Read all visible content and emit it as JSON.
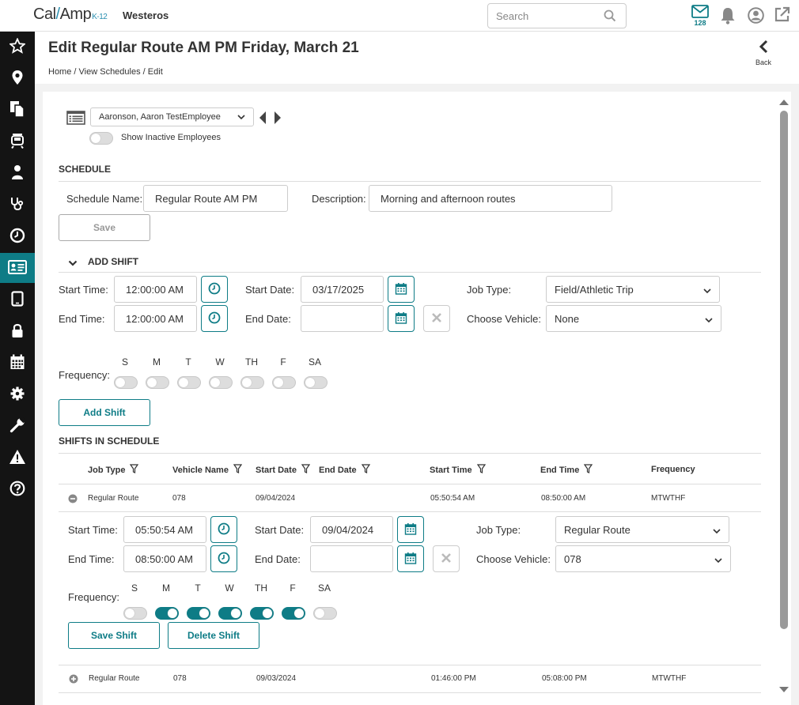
{
  "topbar": {
    "logo_main": "Cal",
    "logo_rest": "Amp",
    "logo_k12": "K-12",
    "org_name": "Westeros",
    "search_placeholder": "Search",
    "mail_count": "128"
  },
  "sidebar": {
    "items": [
      {
        "icon": "star-icon"
      },
      {
        "icon": "map-pin-icon"
      },
      {
        "icon": "documents-icon"
      },
      {
        "icon": "bus-icon"
      },
      {
        "icon": "driver-icon"
      },
      {
        "icon": "stethoscope-icon"
      },
      {
        "icon": "clock-icon"
      },
      {
        "icon": "id-card-icon",
        "active": true
      },
      {
        "icon": "tablet-icon"
      },
      {
        "icon": "lock-icon"
      },
      {
        "icon": "calendar-icon"
      },
      {
        "icon": "gear-icon"
      },
      {
        "icon": "wrench-icon"
      },
      {
        "icon": "warning-icon"
      },
      {
        "icon": "help-icon"
      }
    ],
    "active_color": "#0e7c86"
  },
  "header": {
    "title": "Edit Regular Route AM PM Friday, March 21",
    "breadcrumb": [
      "Home",
      "View Schedules",
      "Edit"
    ],
    "back_label": "Back"
  },
  "employee": {
    "selected": "Aaronson, Aaron TestEmployee",
    "show_inactive_label": "Show Inactive Employees"
  },
  "schedule": {
    "section_title": "SCHEDULE",
    "name_label": "Schedule Name:",
    "name_value": "Regular Route AM PM",
    "description_label": "Description:",
    "description_value": "Morning and afternoon routes",
    "save_label": "Save"
  },
  "add_shift": {
    "section_title": "ADD SHIFT",
    "start_time_label": "Start Time:",
    "start_time_value": "12:00:00 AM",
    "end_time_label": "End Time:",
    "end_time_value": "12:00:00 AM",
    "start_date_label": "Start Date:",
    "start_date_value": "03/17/2025",
    "end_date_label": "End Date:",
    "end_date_value": "",
    "job_type_label": "Job Type:",
    "job_type_value": "Field/Athletic Trip",
    "vehicle_label": "Choose Vehicle:",
    "vehicle_value": "None",
    "frequency_label": "Frequency:",
    "days": [
      "S",
      "M",
      "T",
      "W",
      "TH",
      "F",
      "SA"
    ],
    "days_on": [
      false,
      false,
      false,
      false,
      false,
      false,
      false
    ],
    "add_label": "Add Shift"
  },
  "shifts": {
    "section_title": "SHIFTS IN SCHEDULE",
    "columns": [
      "Job Type",
      "Vehicle Name",
      "Start Date",
      "End Date",
      "Start Time",
      "End Time",
      "Frequency"
    ],
    "rows": [
      {
        "job_type": "Regular Route",
        "vehicle": "078",
        "start_date": "09/04/2024",
        "end_date": "",
        "start_time": "05:50:54 AM",
        "end_time": "08:50:00 AM",
        "frequency": "MTWTHF",
        "expanded": true
      },
      {
        "job_type": "Regular Route",
        "vehicle": "078",
        "start_date": "09/03/2024",
        "end_date": "",
        "start_time": "01:46:00 PM",
        "end_time": "05:08:00 PM",
        "frequency": "MTWTHF",
        "expanded": false
      }
    ],
    "editor": {
      "start_time_label": "Start Time:",
      "start_time_value": "05:50:54 AM",
      "end_time_label": "End Time:",
      "end_time_value": "08:50:00 AM",
      "start_date_label": "Start Date:",
      "start_date_value": "09/04/2024",
      "end_date_label": "End Date:",
      "end_date_value": "",
      "job_type_label": "Job Type:",
      "job_type_value": "Regular Route",
      "vehicle_label": "Choose Vehicle:",
      "vehicle_value": "078",
      "frequency_label": "Frequency:",
      "days": [
        "S",
        "M",
        "T",
        "W",
        "TH",
        "F",
        "SA"
      ],
      "days_on": [
        false,
        true,
        true,
        true,
        true,
        true,
        false
      ],
      "save_label": "Save Shift",
      "delete_label": "Delete Shift"
    }
  }
}
